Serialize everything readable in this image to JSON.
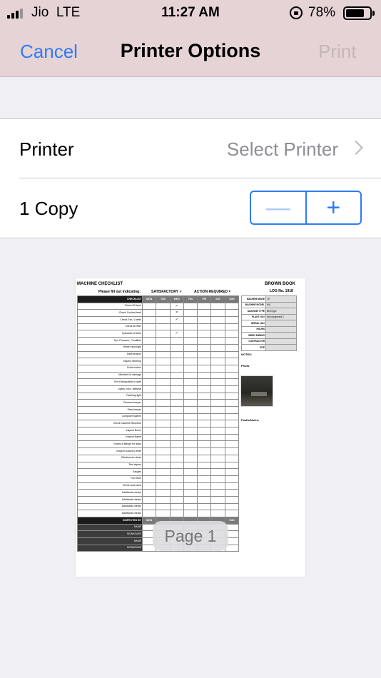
{
  "status_bar": {
    "carrier": "Jio",
    "network": "LTE",
    "time": "11:27 AM",
    "battery_percent_text": "78%",
    "battery_level": 0.78,
    "signal_bars_filled": 3,
    "signal_bars_total": 4
  },
  "nav": {
    "cancel_label": "Cancel",
    "title": "Printer Options",
    "print_label": "Print"
  },
  "printer_row": {
    "label": "Printer",
    "value": "Select Printer"
  },
  "copies_row": {
    "label": "1 Copy",
    "decrement_symbol": "—",
    "increment_symbol": "+"
  },
  "preview": {
    "page_label": "Page 1",
    "document": {
      "title": "MACHINE CHECKLIST",
      "brand": "BROWN BOOK",
      "log_number": "LOG No. 1918",
      "instructions": "Please fill out indicating:",
      "satisfactory_legend": "SATISFACTORY ✓",
      "action_legend": "ACTION REQUIRED ×",
      "checklist_header": "CHECKLIST",
      "days": [
        "MON",
        "TUE",
        "WED",
        "THU",
        "FRI",
        "SAT",
        "SUN"
      ],
      "items": [
        {
          "label": "Check Oil level",
          "wed": "✓"
        },
        {
          "label": "Check Coolant level",
          "wed": "×"
        },
        {
          "label": "Check Fan, V-belts",
          "wed": "✓"
        },
        {
          "label": "Check Air filter",
          "wed": ""
        },
        {
          "label": "Hydraulic oil level",
          "wed": "✓"
        },
        {
          "label": "Tyre Pressure, Condition",
          "wed": ""
        },
        {
          "label": "Wheel nuts-tight",
          "wed": ""
        },
        {
          "label": "Track tension",
          "wed": ""
        },
        {
          "label": "Inspect Steering",
          "wed": ""
        },
        {
          "label": "Drive motors",
          "wed": ""
        },
        {
          "label": "Machine for damage",
          "wed": ""
        },
        {
          "label": "Fire Extinguisher in date",
          "wed": ""
        },
        {
          "label": "Lights, horn, beltseat",
          "wed": ""
        },
        {
          "label": "Flashing light",
          "wed": ""
        },
        {
          "label": "Reverse beeper",
          "wed": ""
        },
        {
          "label": "Slew beeper",
          "wed": ""
        },
        {
          "label": "Computer system",
          "wed": ""
        },
        {
          "label": "Check machine Structure",
          "wed": ""
        },
        {
          "label": "Inspect Boom",
          "wed": ""
        },
        {
          "label": "Inspect Name",
          "wed": ""
        },
        {
          "label": "Hoses & fittings for leaks",
          "wed": ""
        },
        {
          "label": "Inspect bucket & teeth",
          "wed": ""
        },
        {
          "label": "Windscreen clean",
          "wed": ""
        },
        {
          "label": "Test wipers",
          "wed": ""
        },
        {
          "label": "Gauges",
          "wed": ""
        },
        {
          "label": "Fuel level",
          "wed": ""
        },
        {
          "label": "Check work area",
          "wed": ""
        },
        {
          "label": "Additional checks",
          "wed": ""
        },
        {
          "label": "Additional checks",
          "wed": ""
        },
        {
          "label": "Additional checks",
          "wed": ""
        },
        {
          "label": "Additional checks",
          "wed": ""
        }
      ],
      "inspected_by_label": "INSPECTED BY",
      "inspected_days": [
        "MON",
        "",
        "",
        "",
        "",
        "",
        "SUN"
      ],
      "signature_rows": [
        "NAME",
        "SIGNATURE",
        "NAME",
        "SIGNATURE"
      ],
      "info_fields": [
        {
          "label": "MACHINE MAKE",
          "value": "JH"
        },
        {
          "label": "MACHINE MODEL",
          "value": "NVI"
        },
        {
          "label": "MACHINE TYPE",
          "value": "Bent type"
        },
        {
          "label": "PLANT NO#",
          "value": "Key equipment 1"
        },
        {
          "label": "SERIAL NO#",
          "value": ""
        },
        {
          "label": "HOURS",
          "value": ""
        },
        {
          "label": "WEEK ENDING",
          "value": ""
        },
        {
          "label": "CONTRACTOR",
          "value": ""
        },
        {
          "label": "SITE",
          "value": ""
        }
      ],
      "notes_label": "NOTES:",
      "photo_label": "Photo:",
      "faults_label": "Faults/Notes:"
    }
  },
  "colors": {
    "accent": "#2f7bf6",
    "header_bg": "#e6d3d6",
    "page_bg": "#efeff4",
    "disabled_text": "#c5b6b8",
    "secondary_text": "#8e8e93"
  }
}
